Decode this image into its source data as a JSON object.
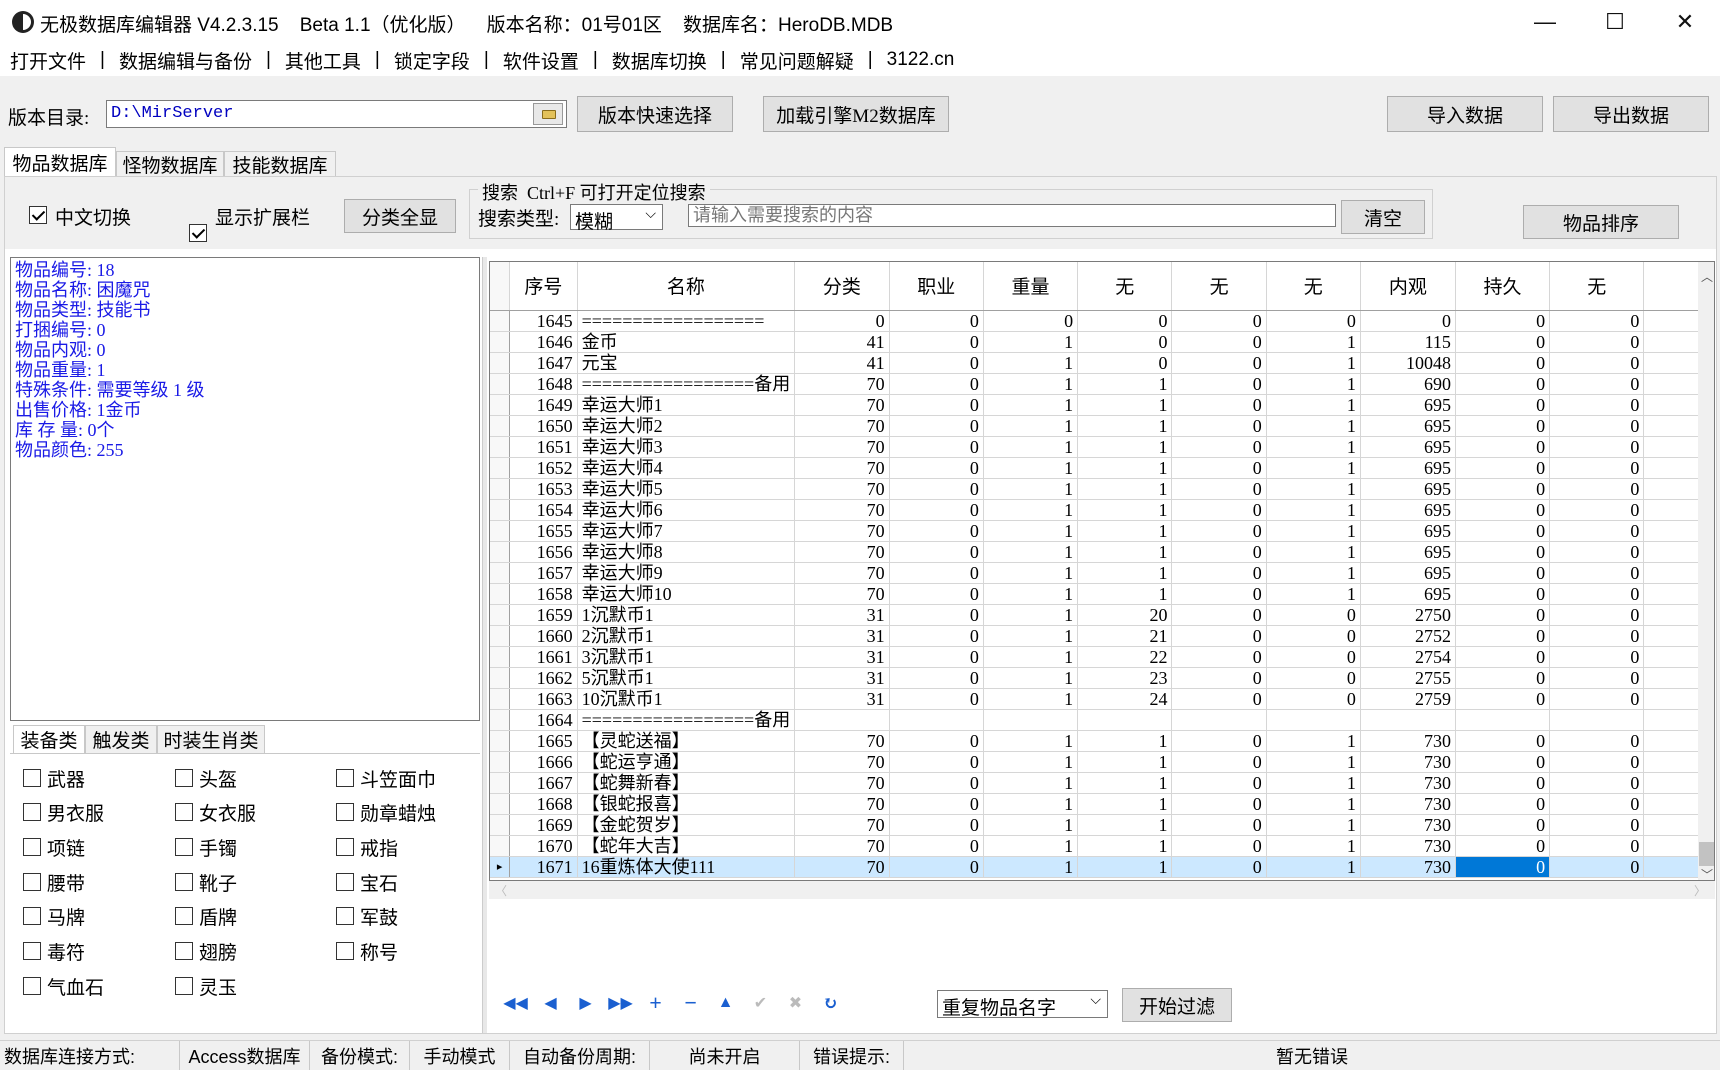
{
  "window": {
    "title": "无极数据库编辑器 V4.2.3.15    Beta 1.1（优化版）    版本名称：01号01区    数据库名：HeroDB.MDB",
    "minimize": "—",
    "maximize": "☐",
    "close": "✕"
  },
  "menu": [
    "打开文件",
    "数据编辑与备份",
    "其他工具",
    "锁定字段",
    "软件设置",
    "数据库切换",
    "常见问题解疑",
    "3122.cn"
  ],
  "menu_sep": "|",
  "toolbar": {
    "version_dir_label": "版本目录:",
    "version_dir_value": "D:\\MirServer",
    "quick_select": "版本快速选择",
    "load_m2": "加载引擎M2数据库",
    "import": "导入数据",
    "export": "导出数据"
  },
  "db_tabs": [
    "物品数据库",
    "怪物数据库",
    "技能数据库"
  ],
  "filters": {
    "chinese_switch": "中文切换",
    "show_ext": "显示扩展栏",
    "show_all_cat": "分类全显",
    "search_legend": "搜索  Ctrl+F 可打开定位搜索",
    "search_type_label": "搜索类型:",
    "search_type_value": "模糊",
    "search_placeholder": "请输入需要搜索的内容",
    "clear": "清空",
    "sort": "物品排序"
  },
  "info": [
    "物品编号: 18",
    "物品名称: 困魔咒",
    "物品类型: 技能书",
    "打捆编号: 0",
    "物品内观: 0",
    "物品重量: 1",
    "特殊条件: 需要等级 1 级",
    "出售价格: 1金币",
    "库 存 量: 0个",
    "物品颜色: 255"
  ],
  "cat_tabs": [
    "装备类",
    "触发类",
    "时装生肖类"
  ],
  "categories": [
    "武器",
    "头盔",
    "斗笠面巾",
    "男衣服",
    "女衣服",
    "勋章蜡烛",
    "项链",
    "手镯",
    "戒指",
    "腰带",
    "靴子",
    "宝石",
    "马牌",
    "盾牌",
    "军鼓",
    "毒符",
    "翅膀",
    "称号",
    "气血石",
    "灵玉"
  ],
  "grid": {
    "columns": [
      "序号",
      "名称",
      "分类",
      "职业",
      "重量",
      "无",
      "无",
      "无",
      "内观",
      "持久",
      "无"
    ],
    "rows": [
      [
        "1645",
        "==================",
        "0",
        "0",
        "0",
        "0",
        "0",
        "0",
        "0",
        "0",
        "0"
      ],
      [
        "1646",
        "金币",
        "41",
        "0",
        "1",
        "0",
        "0",
        "1",
        "115",
        "0",
        "0"
      ],
      [
        "1647",
        "元宝",
        "41",
        "0",
        "1",
        "0",
        "0",
        "1",
        "10048",
        "0",
        "0"
      ],
      [
        "1648",
        "=================备用",
        "70",
        "0",
        "1",
        "1",
        "0",
        "1",
        "690",
        "0",
        "0"
      ],
      [
        "1649",
        "幸运大师1",
        "70",
        "0",
        "1",
        "1",
        "0",
        "1",
        "695",
        "0",
        "0"
      ],
      [
        "1650",
        "幸运大师2",
        "70",
        "0",
        "1",
        "1",
        "0",
        "1",
        "695",
        "0",
        "0"
      ],
      [
        "1651",
        "幸运大师3",
        "70",
        "0",
        "1",
        "1",
        "0",
        "1",
        "695",
        "0",
        "0"
      ],
      [
        "1652",
        "幸运大师4",
        "70",
        "0",
        "1",
        "1",
        "0",
        "1",
        "695",
        "0",
        "0"
      ],
      [
        "1653",
        "幸运大师5",
        "70",
        "0",
        "1",
        "1",
        "0",
        "1",
        "695",
        "0",
        "0"
      ],
      [
        "1654",
        "幸运大师6",
        "70",
        "0",
        "1",
        "1",
        "0",
        "1",
        "695",
        "0",
        "0"
      ],
      [
        "1655",
        "幸运大师7",
        "70",
        "0",
        "1",
        "1",
        "0",
        "1",
        "695",
        "0",
        "0"
      ],
      [
        "1656",
        "幸运大师8",
        "70",
        "0",
        "1",
        "1",
        "0",
        "1",
        "695",
        "0",
        "0"
      ],
      [
        "1657",
        "幸运大师9",
        "70",
        "0",
        "1",
        "1",
        "0",
        "1",
        "695",
        "0",
        "0"
      ],
      [
        "1658",
        "幸运大师10",
        "70",
        "0",
        "1",
        "1",
        "0",
        "1",
        "695",
        "0",
        "0"
      ],
      [
        "1659",
        "1沉默币1",
        "31",
        "0",
        "1",
        "20",
        "0",
        "0",
        "2750",
        "0",
        "0"
      ],
      [
        "1660",
        "2沉默币1",
        "31",
        "0",
        "1",
        "21",
        "0",
        "0",
        "2752",
        "0",
        "0"
      ],
      [
        "1661",
        "3沉默币1",
        "31",
        "0",
        "1",
        "22",
        "0",
        "0",
        "2754",
        "0",
        "0"
      ],
      [
        "1662",
        "5沉默币1",
        "31",
        "0",
        "1",
        "23",
        "0",
        "0",
        "2755",
        "0",
        "0"
      ],
      [
        "1663",
        "10沉默币1",
        "31",
        "0",
        "1",
        "24",
        "0",
        "0",
        "2759",
        "0",
        "0"
      ],
      [
        "1664",
        "=================备用",
        "",
        "",
        "",
        "",
        "",
        "",
        "",
        "",
        ""
      ],
      [
        "1665",
        "【灵蛇送福】",
        "70",
        "0",
        "1",
        "1",
        "0",
        "1",
        "730",
        "0",
        "0"
      ],
      [
        "1666",
        "【蛇运亨通】",
        "70",
        "0",
        "1",
        "1",
        "0",
        "1",
        "730",
        "0",
        "0"
      ],
      [
        "1667",
        "【蛇舞新春】",
        "70",
        "0",
        "1",
        "1",
        "0",
        "1",
        "730",
        "0",
        "0"
      ],
      [
        "1668",
        "【银蛇报喜】",
        "70",
        "0",
        "1",
        "1",
        "0",
        "1",
        "730",
        "0",
        "0"
      ],
      [
        "1669",
        "【金蛇贺岁】",
        "70",
        "0",
        "1",
        "1",
        "0",
        "1",
        "730",
        "0",
        "0"
      ],
      [
        "1670",
        "【蛇年大吉】",
        "70",
        "0",
        "1",
        "1",
        "0",
        "1",
        "730",
        "0",
        "0"
      ],
      [
        "1671",
        "16重炼体大使111",
        "70",
        "0",
        "1",
        "1",
        "0",
        "1",
        "730",
        "0",
        "0"
      ]
    ]
  },
  "bottom": {
    "dup_select": "重复物品名字",
    "start_filter": "开始过滤"
  },
  "status": {
    "conn_label": "数据库连接方式:",
    "conn_value": "Access数据库",
    "backup_label": "备份模式:",
    "backup_value": "手动模式",
    "auto_label": "自动备份周期:",
    "auto_value": "尚未开启",
    "err_label": "错误提示:",
    "err_value": "暂无错误"
  }
}
